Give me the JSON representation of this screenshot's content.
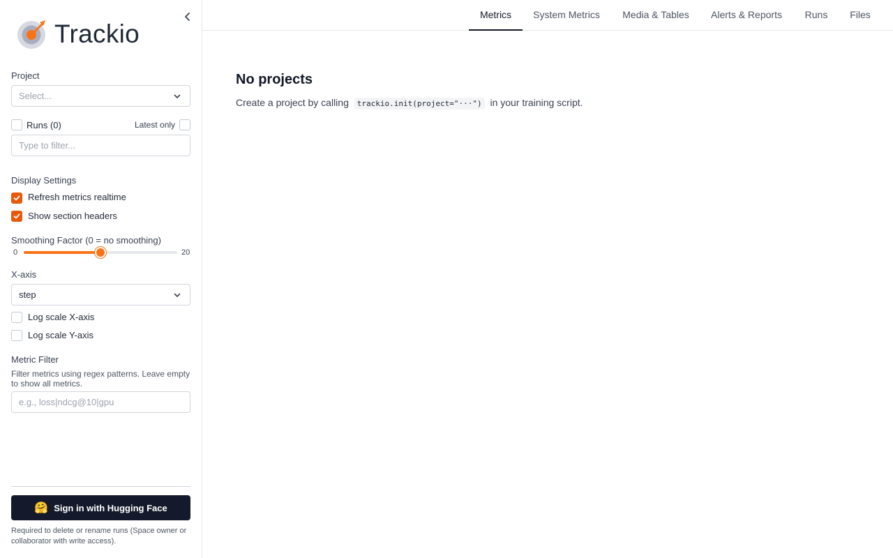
{
  "app": {
    "name": "Trackio"
  },
  "sidebar": {
    "project_label": "Project",
    "project_select": {
      "placeholder": "Select..."
    },
    "runs_label": "Runs (0)",
    "latest_only_label": "Latest only",
    "runs_filter_placeholder": "Type to filter...",
    "display_settings_label": "Display Settings",
    "refresh_realtime": {
      "label": "Refresh metrics realtime",
      "checked": true
    },
    "show_section_headers": {
      "label": "Show section headers",
      "checked": true
    },
    "smoothing": {
      "label": "Smoothing Factor (0 = no smoothing)",
      "min": "0",
      "max": "20",
      "value": 10
    },
    "xaxis_label": "X-axis",
    "xaxis_value": "step",
    "log_x": {
      "label": "Log scale X-axis",
      "checked": false
    },
    "log_y": {
      "label": "Log scale Y-axis",
      "checked": false
    },
    "metric_filter_label": "Metric Filter",
    "metric_filter_help": "Filter metrics using regex patterns. Leave empty to show all metrics.",
    "metric_filter_placeholder": "e.g., loss|ndcg@10|gpu",
    "signin_label": "Sign in with Hugging Face",
    "signin_note": "Required to delete or rename runs (Space owner or collaborator with write access)."
  },
  "tabs": [
    {
      "label": "Metrics",
      "active": true
    },
    {
      "label": "System Metrics",
      "active": false
    },
    {
      "label": "Media & Tables",
      "active": false
    },
    {
      "label": "Alerts & Reports",
      "active": false
    },
    {
      "label": "Runs",
      "active": false
    },
    {
      "label": "Files",
      "active": false
    }
  ],
  "main": {
    "empty_title": "No projects",
    "empty_text_before": "Create a project by calling",
    "empty_code": "trackio.init(project=\"···\")",
    "empty_text_after": "in your training script."
  },
  "colors": {
    "accent": "#f97316",
    "checkbox": "#e8590c",
    "signin_bg": "#141a2b"
  }
}
